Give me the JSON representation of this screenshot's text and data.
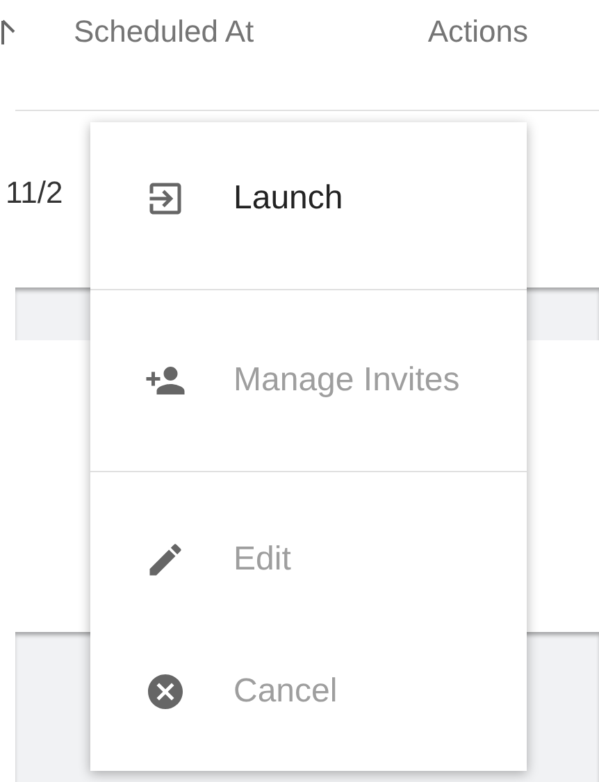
{
  "table": {
    "columns": [
      {
        "label": "Scheduled At"
      },
      {
        "label": "Actions"
      }
    ],
    "rows": [
      {
        "column_1": "11/2"
      }
    ]
  },
  "menu": {
    "items": [
      {
        "label": "Launch",
        "disabled": false,
        "divider_after": true
      },
      {
        "label": "Manage Invites",
        "disabled": true,
        "divider_after": true
      },
      {
        "label": "Edit",
        "disabled": true,
        "divider_after": false
      },
      {
        "label": "Cancel",
        "disabled": true,
        "divider_after": false
      }
    ]
  }
}
